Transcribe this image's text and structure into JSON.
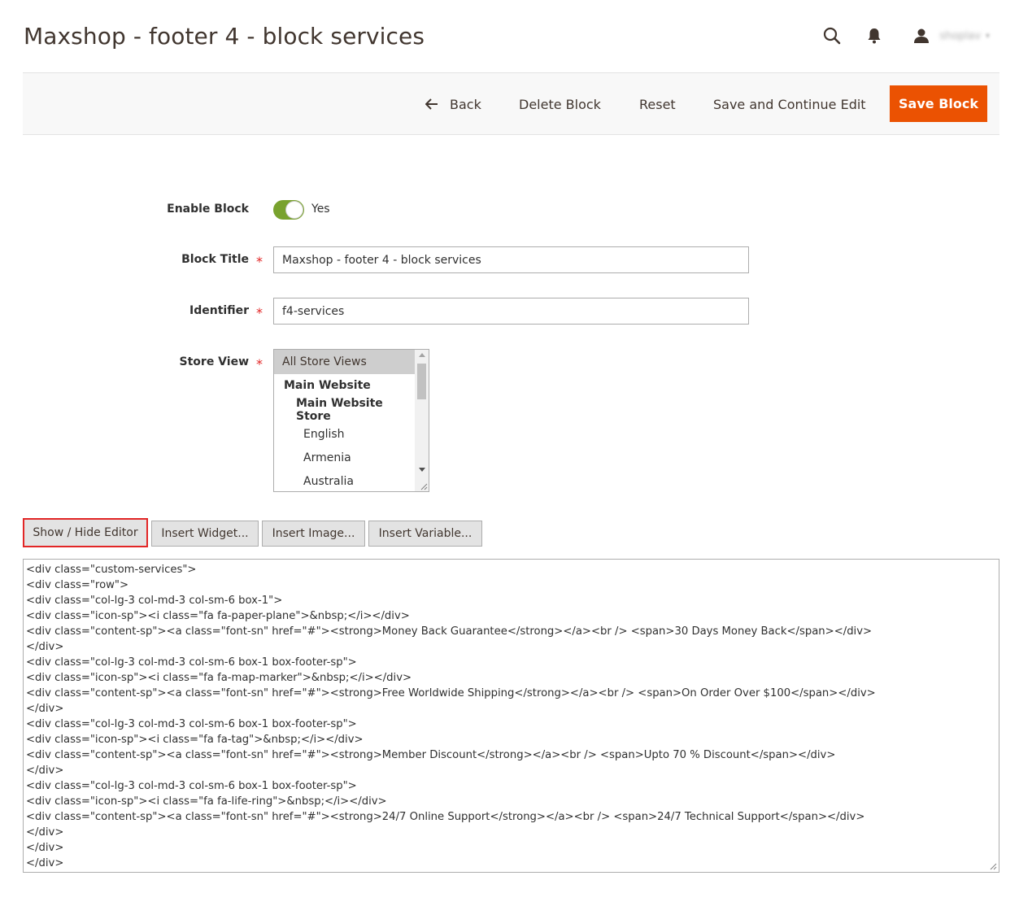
{
  "page": {
    "title": "Maxshop - footer 4 - block services"
  },
  "header": {
    "search_icon": "search-icon",
    "notifications_icon": "bell-icon",
    "user_icon": "user-icon",
    "user_name": "shoplav",
    "user_caret": "▾"
  },
  "toolbar": {
    "back_label": "Back",
    "delete_label": "Delete Block",
    "reset_label": "Reset",
    "save_continue_label": "Save and Continue Edit",
    "save_label": "Save Block",
    "accent_color": "#eb5202"
  },
  "form": {
    "enable": {
      "label": "Enable Block",
      "value": "Yes",
      "checked": true,
      "color": "#79a22e"
    },
    "title": {
      "label": "Block Title",
      "required_mark": "*",
      "value": "Maxshop - footer 4 - block services"
    },
    "identifier": {
      "label": "Identifier",
      "required_mark": "*",
      "value": "f4-services"
    },
    "store_view": {
      "label": "Store View",
      "required_mark": "*",
      "options": [
        {
          "label": "All Store Views",
          "selected": true
        },
        {
          "label": "Main Website"
        },
        {
          "label": "Main Website Store"
        },
        {
          "label": "English"
        },
        {
          "label": "Armenia"
        },
        {
          "label": "Australia"
        }
      ]
    }
  },
  "editor": {
    "buttons": {
      "show_hide": "Show / Hide Editor",
      "insert_widget": "Insert Widget...",
      "insert_image": "Insert Image...",
      "insert_variable": "Insert Variable..."
    },
    "content": "<div class=\"custom-services\">\n<div class=\"row\">\n<div class=\"col-lg-3 col-md-3 col-sm-6 box-1\">\n<div class=\"icon-sp\"><i class=\"fa fa-paper-plane\">&nbsp;</i></div>\n<div class=\"content-sp\"><a class=\"font-sn\" href=\"#\"><strong>Money Back Guarantee</strong></a><br /> <span>30 Days Money Back</span></div>\n</div>\n<div class=\"col-lg-3 col-md-3 col-sm-6 box-1 box-footer-sp\">\n<div class=\"icon-sp\"><i class=\"fa fa-map-marker\">&nbsp;</i></div>\n<div class=\"content-sp\"><a class=\"font-sn\" href=\"#\"><strong>Free Worldwide Shipping</strong></a><br /> <span>On Order Over $100</span></div>\n</div>\n<div class=\"col-lg-3 col-md-3 col-sm-6 box-1 box-footer-sp\">\n<div class=\"icon-sp\"><i class=\"fa fa-tag\">&nbsp;</i></div>\n<div class=\"content-sp\"><a class=\"font-sn\" href=\"#\"><strong>Member Discount</strong></a><br /> <span>Upto 70 % Discount</span></div>\n</div>\n<div class=\"col-lg-3 col-md-3 col-sm-6 box-1 box-footer-sp\">\n<div class=\"icon-sp\"><i class=\"fa fa-life-ring\">&nbsp;</i></div>\n<div class=\"content-sp\"><a class=\"font-sn\" href=\"#\"><strong>24/7 Online Support</strong></a><br /> <span>24/7 Technical Support</span></div>\n</div>\n</div>\n</div>"
  }
}
